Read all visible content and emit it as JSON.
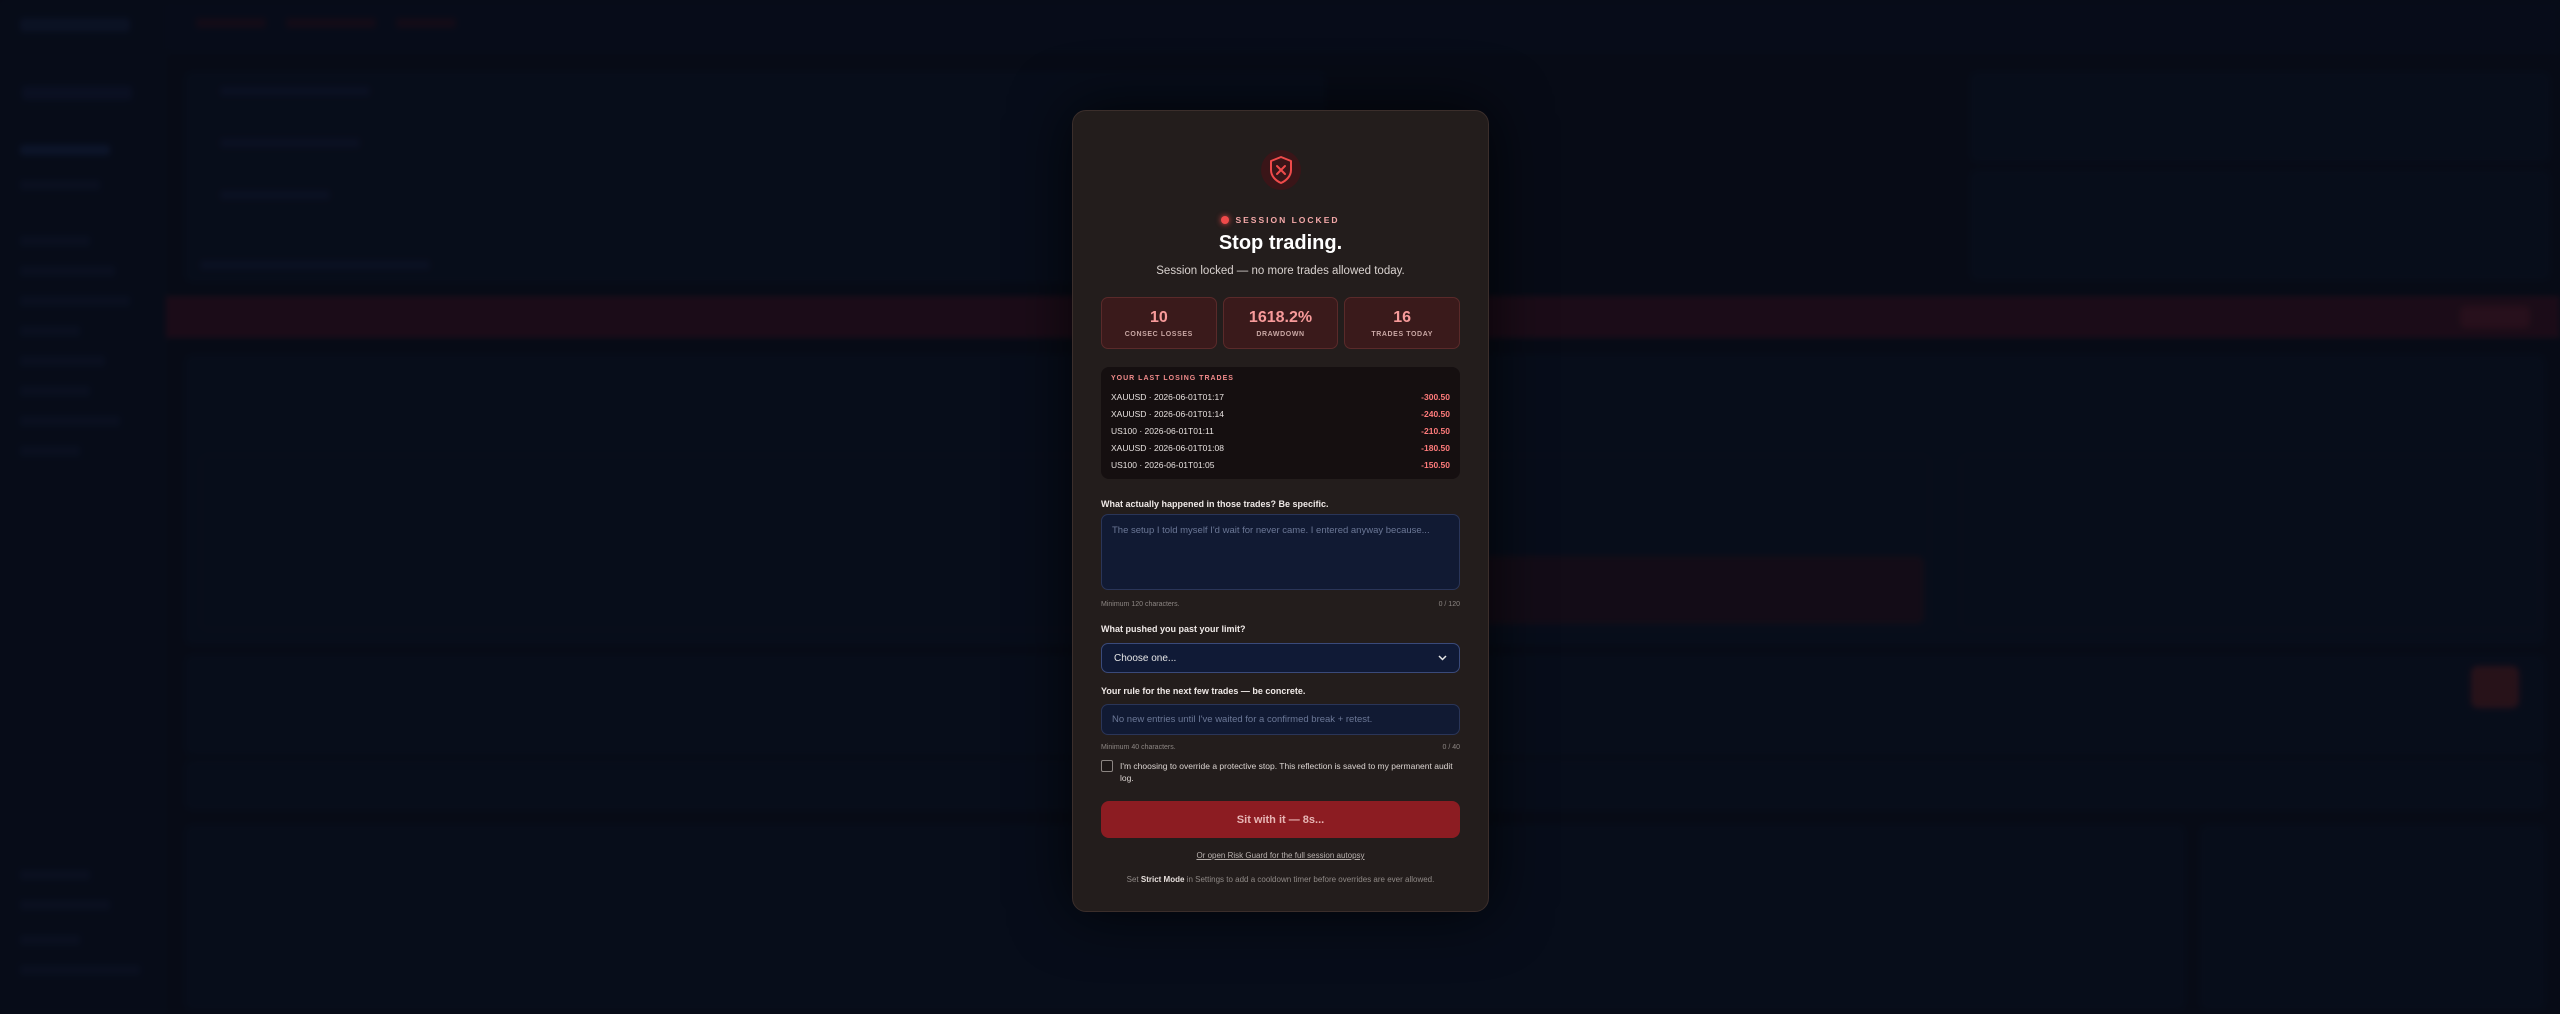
{
  "modal": {
    "status": "SESSION LOCKED",
    "title": "Stop trading.",
    "subtitle": "Session locked — no more trades allowed today.",
    "stats": [
      {
        "value": "10",
        "label": "CONSEC LOSSES"
      },
      {
        "value": "1618.2%",
        "label": "DRAWDOWN"
      },
      {
        "value": "16",
        "label": "TRADES TODAY"
      }
    ],
    "losing_trades": {
      "header": "YOUR LAST LOSING TRADES",
      "rows": [
        {
          "name": "XAUUSD · 2026-06-01T01:17",
          "pnl": "-300.50"
        },
        {
          "name": "XAUUSD · 2026-06-01T01:14",
          "pnl": "-240.50"
        },
        {
          "name": "US100 · 2026-06-01T01:11",
          "pnl": "-210.50"
        },
        {
          "name": "XAUUSD · 2026-06-01T01:08",
          "pnl": "-180.50"
        },
        {
          "name": "US100 · 2026-06-01T01:05",
          "pnl": "-150.50"
        }
      ]
    },
    "q1": {
      "label": "What actually happened in those trades? Be specific.",
      "placeholder": "The setup I told myself I'd wait for never came. I entered anyway because...",
      "hint": "Minimum 120 characters.",
      "counter": "0 / 120"
    },
    "q2": {
      "label": "What pushed you past your limit?",
      "selected": "Choose one..."
    },
    "q3": {
      "label": "Your rule for the next few trades — be concrete.",
      "placeholder": "No new entries until I've waited for a confirmed break + retest.",
      "hint": "Minimum 40 characters.",
      "counter": "0 / 40"
    },
    "checkbox_label": "I'm choosing to override a protective stop. This reflection is saved to my permanent audit log.",
    "primary_button": "Sit with it — 8s...",
    "link": "Or open Risk Guard for the full session autopsy",
    "footer_prefix": "Set ",
    "footer_bold": "Strict Mode",
    "footer_suffix": " in Settings to add a cooldown timer before overrides are ever allowed."
  },
  "colors": {
    "accent_red": "#ef4a4a",
    "modal_bg": "#231d1c",
    "button_bg": "#8c1c22"
  }
}
